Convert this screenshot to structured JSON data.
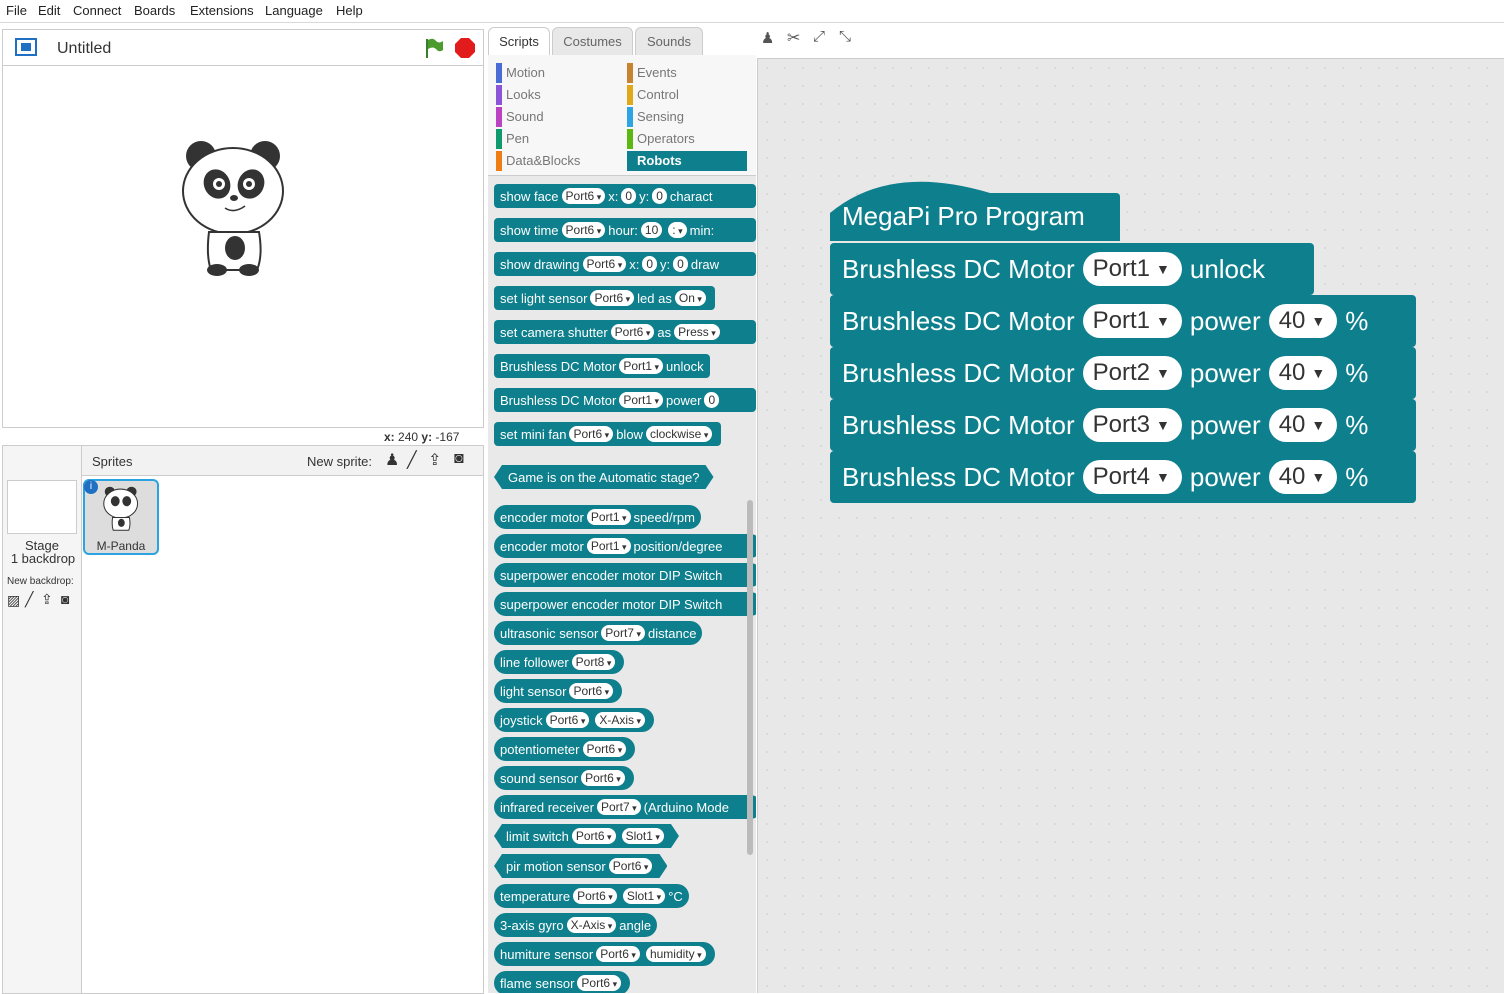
{
  "menu": [
    "File",
    "Edit",
    "Connect",
    "Boards",
    "Extensions",
    "Language",
    "Help"
  ],
  "project": {
    "title": "Untitled"
  },
  "stage_coords": {
    "x_label": "x:",
    "x": "240",
    "y_label": "y:",
    "y": "-167"
  },
  "sprites": {
    "header": "Sprites",
    "new_sprite": "New sprite:",
    "stage_label": "Stage",
    "backdrop_count": "1 backdrop",
    "new_backdrop": "New backdrop:",
    "items": [
      {
        "name": "M-Panda"
      }
    ]
  },
  "tabs": [
    "Scripts",
    "Costumes",
    "Sounds"
  ],
  "categories": {
    "left": [
      {
        "label": "Motion",
        "color": "#4a6cd4"
      },
      {
        "label": "Looks",
        "color": "#8a55d7"
      },
      {
        "label": "Sound",
        "color": "#bb42c3"
      },
      {
        "label": "Pen",
        "color": "#0e9a6c"
      },
      {
        "label": "Data&Blocks",
        "color": "#ee7d16"
      }
    ],
    "right": [
      {
        "label": "Events",
        "color": "#c88330"
      },
      {
        "label": "Control",
        "color": "#e1a91a"
      },
      {
        "label": "Sensing",
        "color": "#2ca5e2"
      },
      {
        "label": "Operators",
        "color": "#5cb712"
      },
      {
        "label": "Robots",
        "color": "#0e7f8c"
      }
    ]
  },
  "palette_blocks": {
    "b1": {
      "t1": "show face",
      "p1": "Port6",
      "t2": "x:",
      "p2": "0",
      "t3": "y:",
      "p3": "0",
      "t4": "charact"
    },
    "b2": {
      "t1": "show time",
      "p1": "Port6",
      "t2": "hour:",
      "p2": "10",
      "p3": ":",
      "t3": "min:"
    },
    "b3": {
      "t1": "show drawing",
      "p1": "Port6",
      "t2": "x:",
      "p2": "0",
      "t3": "y:",
      "p3": "0",
      "t4": "draw"
    },
    "b4": {
      "t1": "set light sensor",
      "p1": "Port6",
      "t2": "led as",
      "p2": "On"
    },
    "b5": {
      "t1": "set camera shutter",
      "p1": "Port6",
      "t2": "as",
      "p2": "Press"
    },
    "b6": {
      "t1": "Brushless DC Motor",
      "p1": "Port1",
      "t2": "unlock"
    },
    "b7": {
      "t1": "Brushless DC Motor",
      "p1": "Port1",
      "t2": "power",
      "p2": "0"
    },
    "b8": {
      "t1": "set mini fan",
      "p1": "Port6",
      "t2": "blow",
      "p2": "clockwise"
    },
    "b9": {
      "t1": "Game is on the Automatic stage?"
    },
    "r1": {
      "t1": "encoder motor",
      "p1": "Port1",
      "t2": "speed/rpm"
    },
    "r2": {
      "t1": "encoder motor",
      "p1": "Port1",
      "t2": "position/degree"
    },
    "r3": {
      "t1": "superpower encoder motor DIP Switch"
    },
    "r4": {
      "t1": "superpower encoder motor DIP Switch"
    },
    "r5": {
      "t1": "ultrasonic sensor",
      "p1": "Port7",
      "t2": "distance"
    },
    "r6": {
      "t1": "line follower",
      "p1": "Port8"
    },
    "r7": {
      "t1": "light sensor",
      "p1": "Port6"
    },
    "r8": {
      "t1": "joystick",
      "p1": "Port6",
      "p2": "X-Axis"
    },
    "r9": {
      "t1": "potentiometer",
      "p1": "Port6"
    },
    "r10": {
      "t1": "sound sensor",
      "p1": "Port6"
    },
    "r11": {
      "t1": "infrared receiver",
      "p1": "Port7",
      "t2": "(Arduino Mode"
    },
    "r12": {
      "t1": "limit switch",
      "p1": "Port6",
      "p2": "Slot1"
    },
    "r13": {
      "t1": "pir motion sensor",
      "p1": "Port6"
    },
    "r14": {
      "t1": "temperature",
      "p1": "Port6",
      "p2": "Slot1",
      "t2": "°C"
    },
    "r15": {
      "t1": "3-axis gyro",
      "p1": "X-Axis",
      "t2": "angle"
    },
    "r16": {
      "t1": "humiture sensor",
      "p1": "Port6",
      "p2": "humidity"
    },
    "r17": {
      "t1": "flame sensor",
      "p1": "Port6"
    }
  },
  "script": {
    "hat": "MegaPi Pro Program",
    "motor_label": "Brushless DC Motor",
    "unlock": {
      "port": "Port1",
      "action": "unlock"
    },
    "power_label": "power",
    "percent": "%",
    "rows": [
      {
        "port": "Port1",
        "value": "40"
      },
      {
        "port": "Port2",
        "value": "40"
      },
      {
        "port": "Port3",
        "value": "40"
      },
      {
        "port": "Port4",
        "value": "40"
      }
    ]
  }
}
